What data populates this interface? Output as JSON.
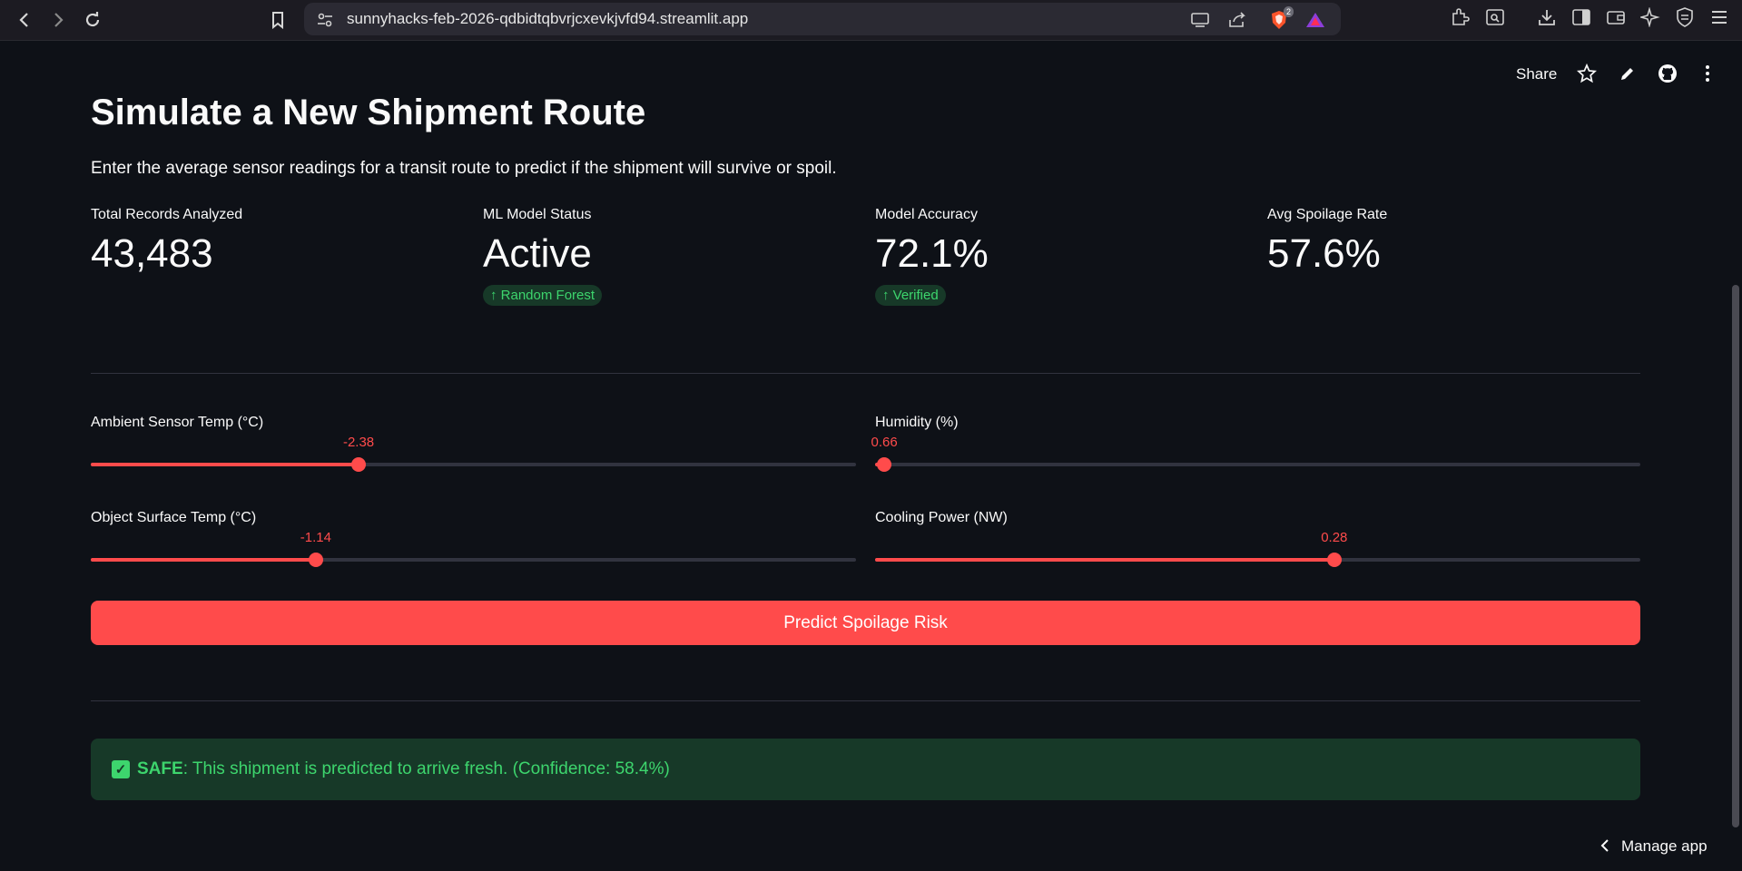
{
  "browser": {
    "url": "sunnyhacks-feb-2026-qdbidtqbvrjcxevkjvfd94.streamlit.app",
    "brave_badge": "2"
  },
  "header": {
    "share_label": "Share"
  },
  "page": {
    "title": "Simulate a New Shipment Route",
    "subtitle": "Enter the average sensor readings for a transit route to predict if the shipment will survive or spoil."
  },
  "metrics": [
    {
      "label": "Total Records Analyzed",
      "value": "43,483",
      "delta": ""
    },
    {
      "label": "ML Model Status",
      "value": "Active",
      "delta": "↑ Random Forest"
    },
    {
      "label": "Model Accuracy",
      "value": "72.1%",
      "delta": "↑ Verified"
    },
    {
      "label": "Avg Spoilage Rate",
      "value": "57.6%",
      "delta": ""
    }
  ],
  "sliders": [
    {
      "label": "Ambient Sensor Temp (°C)",
      "value": "-2.38",
      "fraction": 0.35
    },
    {
      "label": "Humidity (%)",
      "value": "0.66",
      "fraction": 0.012
    },
    {
      "label": "Object Surface Temp (°C)",
      "value": "-1.14",
      "fraction": 0.294
    },
    {
      "label": "Cooling Power (NW)",
      "value": "0.28",
      "fraction": 0.6
    }
  ],
  "predict_button": "Predict Spoilage Risk",
  "result": {
    "icon": "✓",
    "status": "SAFE",
    "message": ": This shipment is predicted to arrive fresh. (Confidence: 58.4%)"
  },
  "footer": {
    "manage_label": "Manage app"
  },
  "colors": {
    "accent": "#ff4b4b",
    "success_bg": "#173928",
    "success_text": "#3dd56d",
    "background": "#0e1117"
  }
}
